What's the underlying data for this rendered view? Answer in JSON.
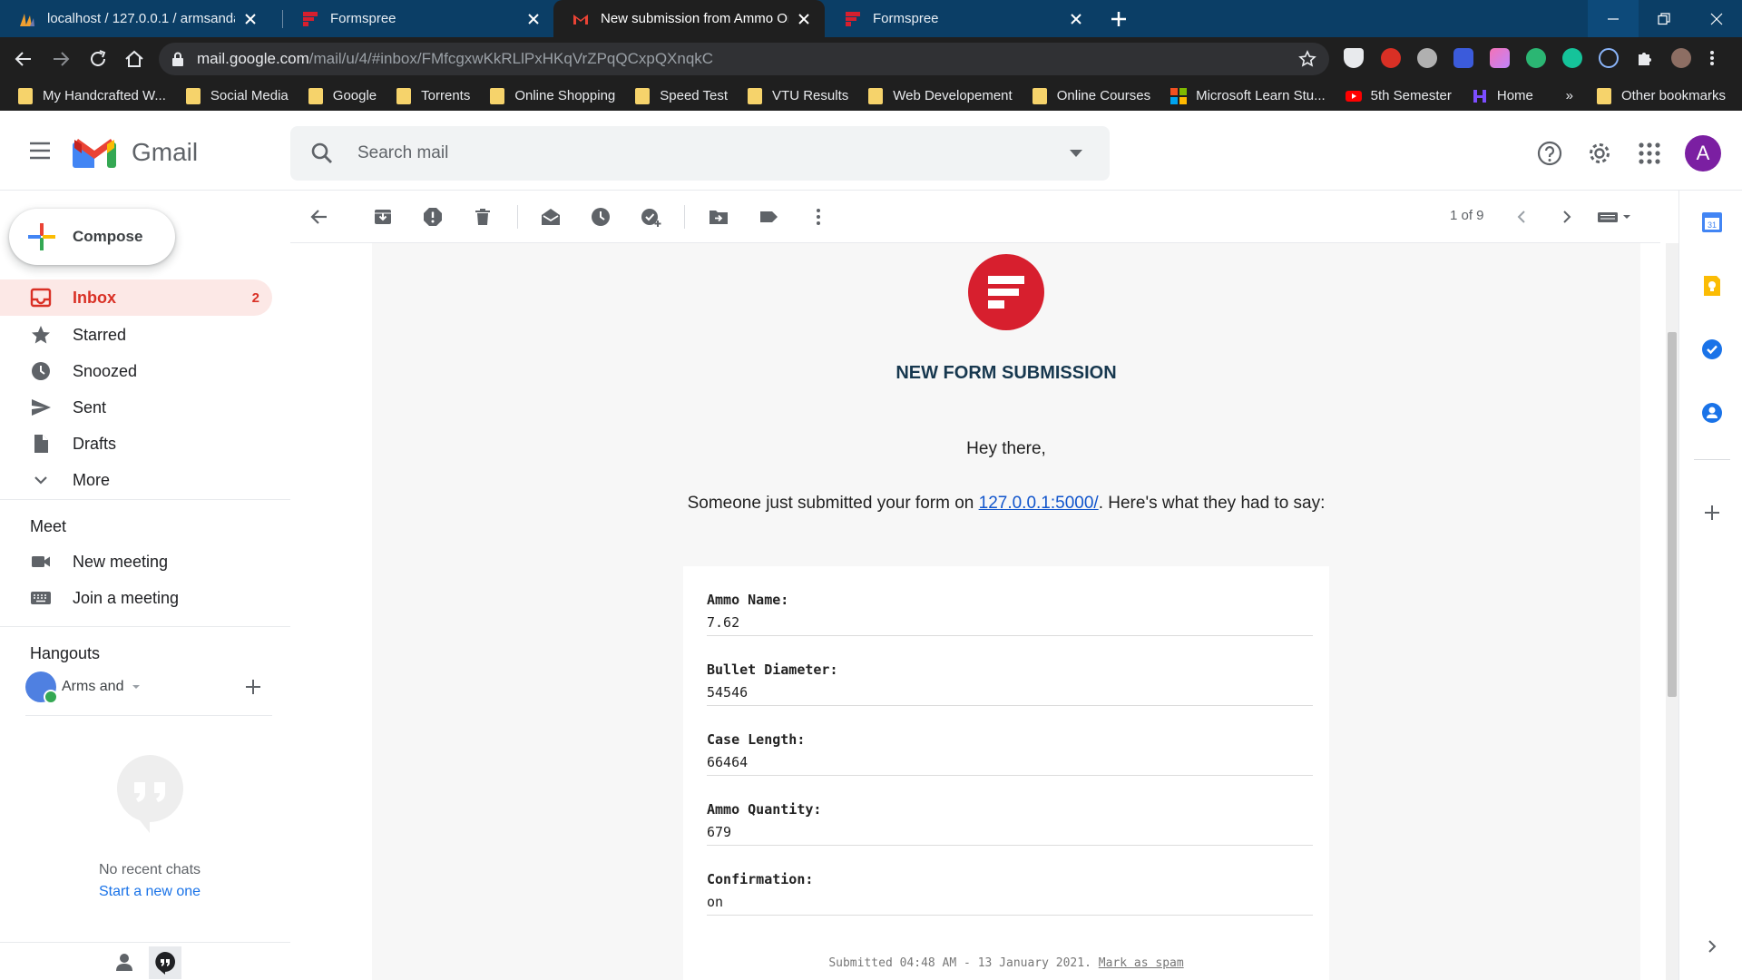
{
  "browser": {
    "tabs": [
      {
        "title": "localhost / 127.0.0.1 / armsandam",
        "favicon": "phpmyadmin-icon"
      },
      {
        "title": "Formspree",
        "favicon": "formspree-icon"
      },
      {
        "title": "New submission from Ammo Or",
        "favicon": "gmail-icon"
      },
      {
        "title": "Formspree",
        "favicon": "formspree-icon"
      }
    ],
    "url_host": "mail.google.com",
    "url_path": "/mail/u/4/#inbox/FMfcgxwKkRLlPxHKqVrZPqQCxpQXnqkC",
    "bookmarks": [
      {
        "label": "My Handcrafted W...",
        "icon": "folder-icon"
      },
      {
        "label": "Social Media",
        "icon": "folder-icon"
      },
      {
        "label": "Google",
        "icon": "folder-icon"
      },
      {
        "label": "Torrents",
        "icon": "folder-icon"
      },
      {
        "label": "Online Shopping",
        "icon": "folder-icon"
      },
      {
        "label": "Speed Test",
        "icon": "folder-icon"
      },
      {
        "label": "VTU Results",
        "icon": "folder-icon"
      },
      {
        "label": "Web Developement",
        "icon": "folder-icon"
      },
      {
        "label": "Online Courses",
        "icon": "folder-icon"
      },
      {
        "label": "Microsoft Learn Stu...",
        "icon": "microsoft-icon"
      },
      {
        "label": "5th Semester",
        "icon": "youtube-icon"
      },
      {
        "label": "Home",
        "icon": "home-logo-icon"
      }
    ],
    "bookmarks_more": "»",
    "other_bookmarks": "Other bookmarks"
  },
  "gmail": {
    "app_name": "Gmail",
    "search_placeholder": "Search mail",
    "avatar_letter": "A",
    "compose_label": "Compose",
    "nav": [
      {
        "label": "Inbox",
        "count": "2",
        "icon": "inbox-icon"
      },
      {
        "label": "Starred",
        "count": "",
        "icon": "star-icon"
      },
      {
        "label": "Snoozed",
        "count": "",
        "icon": "clock-icon"
      },
      {
        "label": "Sent",
        "count": "",
        "icon": "send-icon"
      },
      {
        "label": "Drafts",
        "count": "",
        "icon": "draft-icon"
      },
      {
        "label": "More",
        "count": "",
        "icon": "chevron-down-icon"
      }
    ],
    "meet": {
      "title": "Meet",
      "items": [
        {
          "label": "New meeting",
          "icon": "video-icon"
        },
        {
          "label": "Join a meeting",
          "icon": "keyboard-icon"
        }
      ]
    },
    "hangouts": {
      "title": "Hangouts",
      "user": "Arms and",
      "no_recent": "No recent chats",
      "start_new": "Start a new one"
    },
    "pager": "1 of 9"
  },
  "email": {
    "heading": "NEW FORM SUBMISSION",
    "greeting": "Hey there,",
    "intro_before": "Someone just submitted your form on ",
    "intro_link": "127.0.0.1:5000/",
    "intro_after": ". Here's what they had to say:",
    "fields": [
      {
        "label": "Ammo Name:",
        "value": "7.62"
      },
      {
        "label": "Bullet Diameter:",
        "value": "54546"
      },
      {
        "label": "Case Length:",
        "value": "66464"
      },
      {
        "label": "Ammo Quantity:",
        "value": "679"
      },
      {
        "label": "Confirmation:",
        "value": "on"
      }
    ],
    "submitted": "Submitted 04:48 AM - 13 January 2021.",
    "mark_spam": "Mark as spam"
  },
  "colors": {
    "tab_strip": "#0b3e66",
    "toolbar": "#1f1f1f",
    "gmail_red": "#d93025",
    "formspree_red": "#d71f2e",
    "link": "#1155cc"
  }
}
